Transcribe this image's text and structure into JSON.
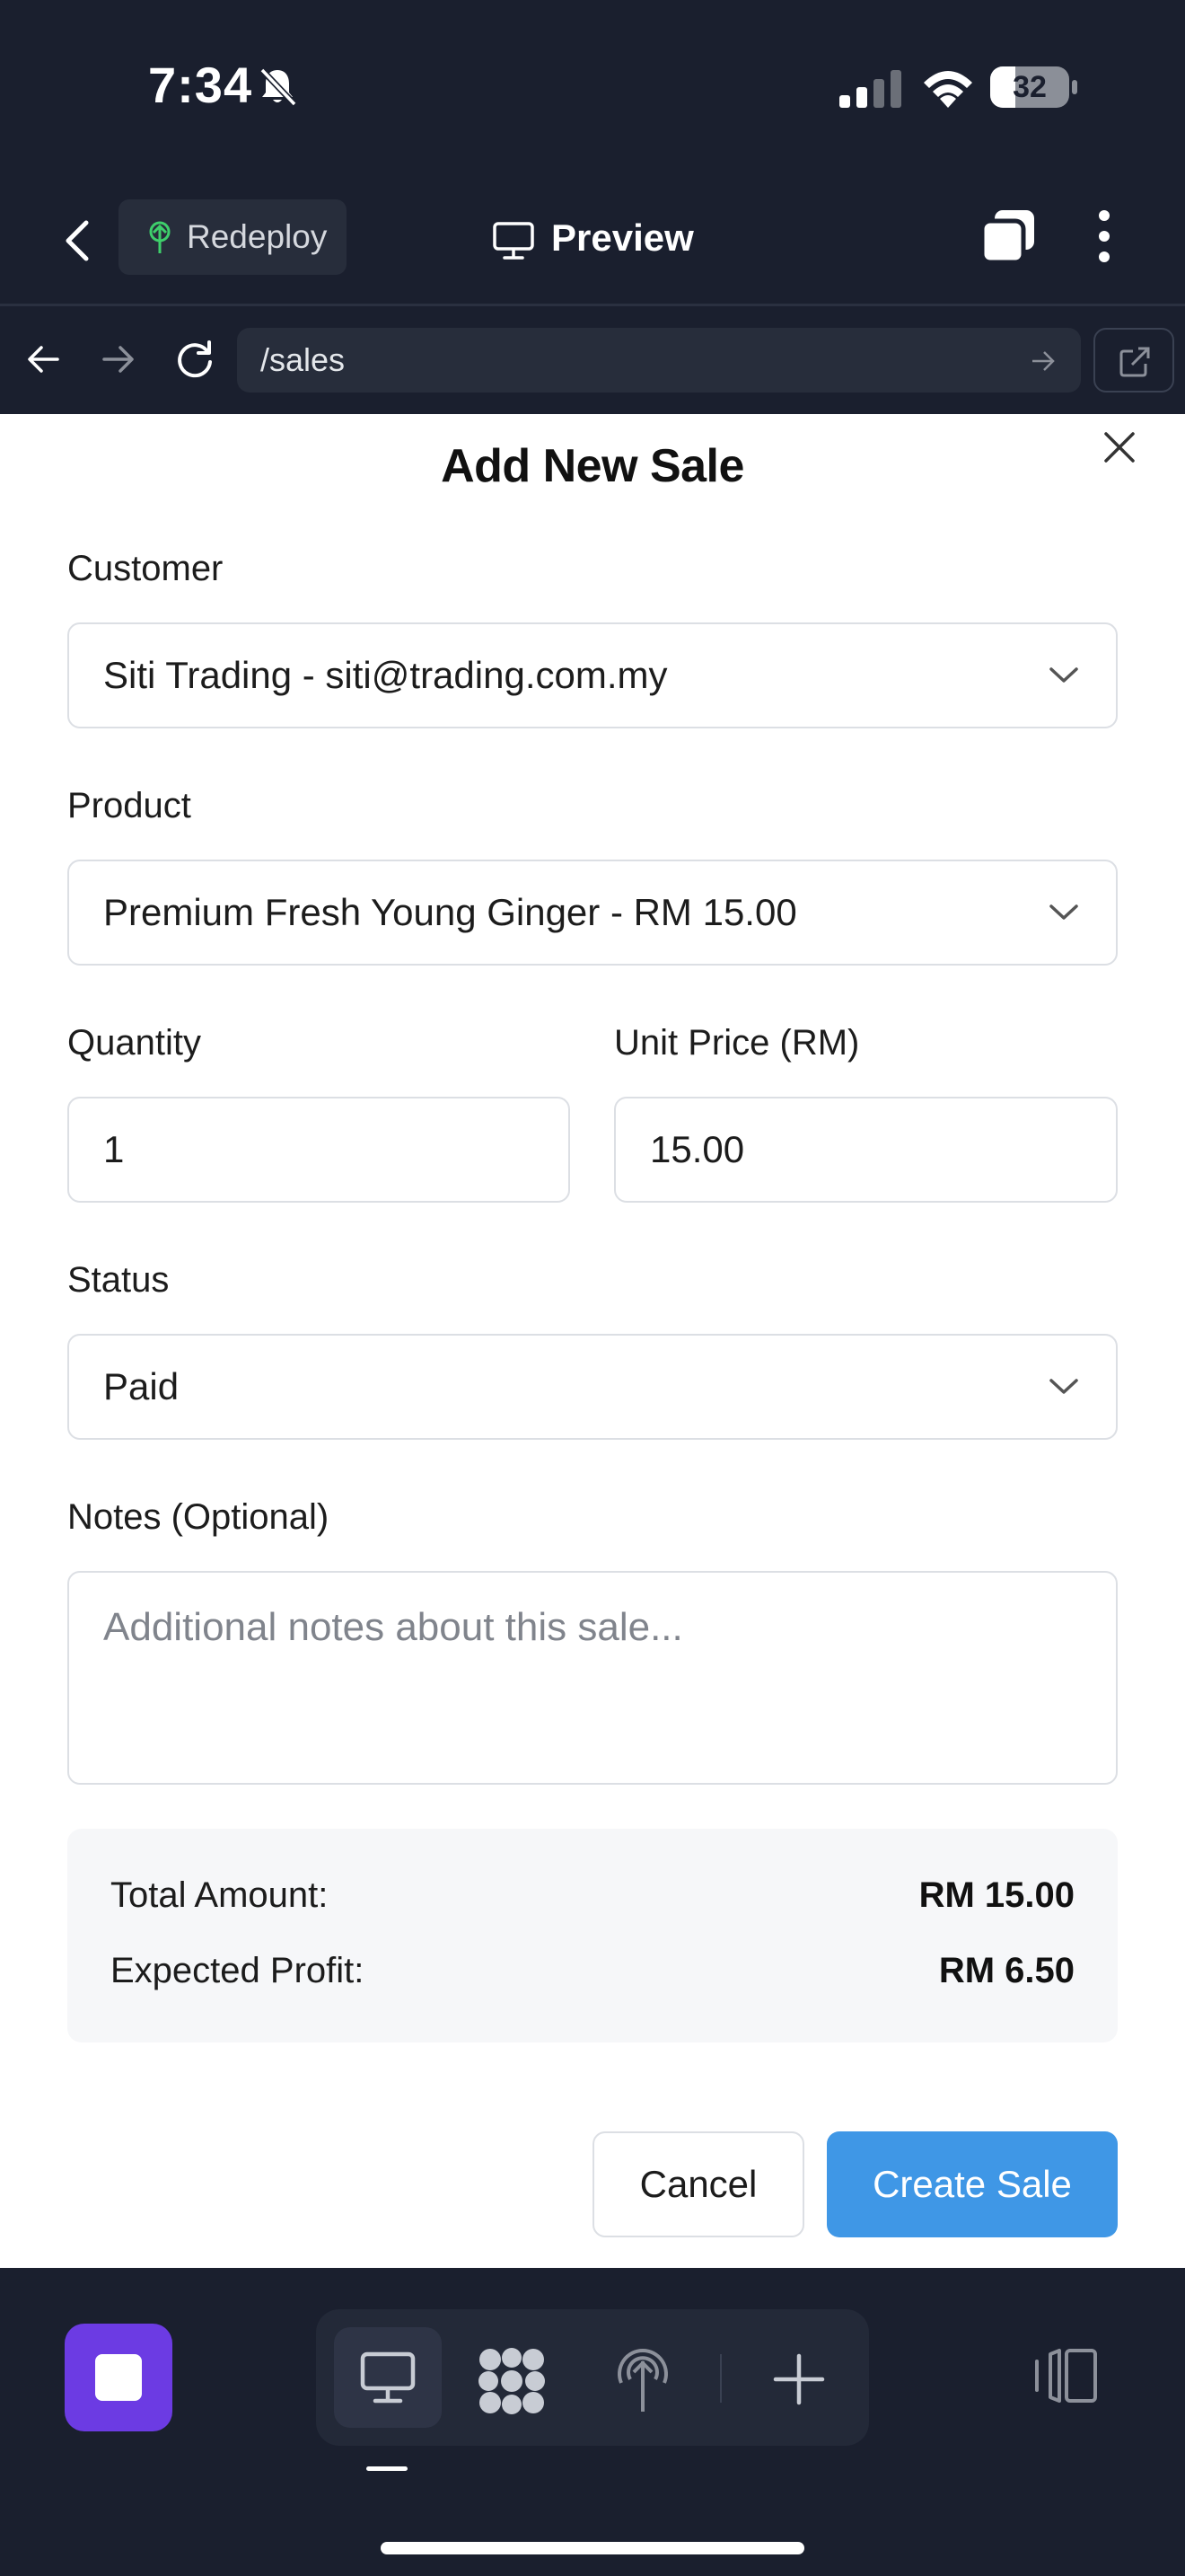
{
  "status_bar": {
    "time": "7:34",
    "battery_level": "32",
    "battery_fraction": 0.32
  },
  "header": {
    "redeploy_label": "Redeploy",
    "preview_label": "Preview"
  },
  "browser": {
    "url": "/sales"
  },
  "modal": {
    "title": "Add New Sale",
    "customer_label": "Customer",
    "customer_value": "Siti Trading - siti@trading.com.my",
    "product_label": "Product",
    "product_value": "Premium Fresh Young Ginger - RM 15.00",
    "quantity_label": "Quantity",
    "quantity_value": "1",
    "unit_price_label": "Unit Price (RM)",
    "unit_price_value": "15.00",
    "status_label": "Status",
    "status_value": "Paid",
    "notes_label": "Notes (Optional)",
    "notes_placeholder": "Additional notes about this sale...",
    "summary": {
      "total_label": "Total Amount:",
      "total_value": "RM 15.00",
      "profit_label": "Expected Profit:",
      "profit_value": "RM 6.50"
    },
    "cancel_label": "Cancel",
    "create_label": "Create Sale"
  },
  "colors": {
    "background_dark": "#1a1f2e",
    "primary_button": "#3f97e6",
    "stop_button": "#6c3be3",
    "redeploy_icon": "#3ecf6b"
  },
  "icons": [
    "bell-slash-icon",
    "signal-icon",
    "wifi-icon",
    "battery-icon",
    "back-icon",
    "redeploy-icon",
    "monitor-icon",
    "tabs-icon",
    "more-icon",
    "arrow-left-icon",
    "arrow-right-icon",
    "reload-icon",
    "external-link-icon",
    "close-icon",
    "chevron-down-icon",
    "stop-icon",
    "desktop-icon",
    "apps-icon",
    "deploy-icon",
    "plus-icon",
    "panel-icon"
  ]
}
